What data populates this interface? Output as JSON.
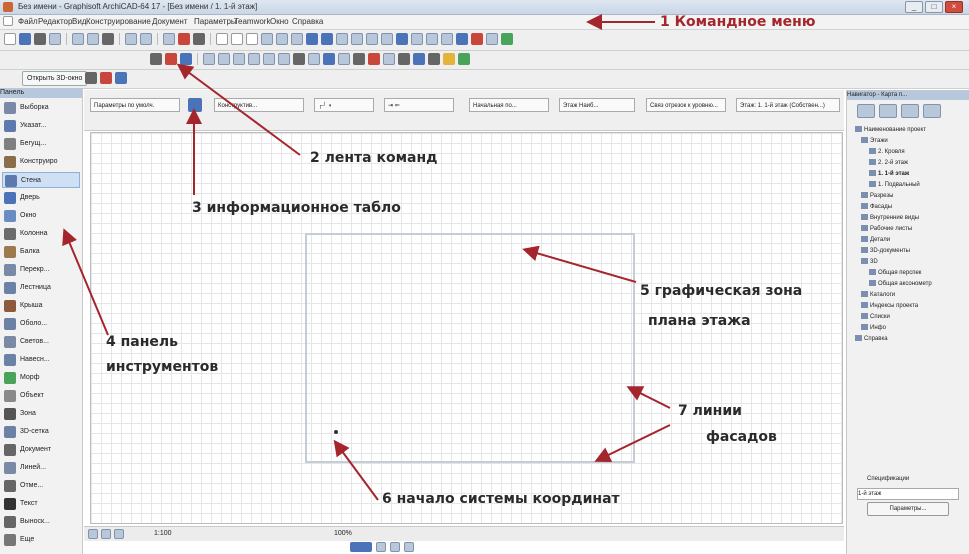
{
  "window": {
    "title": "Без имени - Graphisoft ArchiCAD-64 17 - [Без имени / 1. 1-й этаж]"
  },
  "menu": {
    "items": [
      "Файл",
      "Редактор",
      "Вид",
      "Конструирование",
      "Документ",
      "Параметры",
      "Teamwork",
      "Окно",
      "Справка"
    ],
    "annotation": "1 Командное меню"
  },
  "toolbar": {
    "open_3d_label": "Открыть 3D-окно",
    "annotation": "2 лента команд"
  },
  "info_box": {
    "annotation": "3 информационное табло",
    "param_label": "Параметры по умолч.",
    "construct_label": "Конструктив...",
    "foundation_label": "Начальная по...",
    "floor_label": "Этаж Наиб...",
    "link_label": "Связ отрезок к уровню...",
    "story_label": "Этаж: 1. 1-й этаж (Собствен...)",
    "story_value": "1. 1-й этаж"
  },
  "left_panel": {
    "title": "Панель",
    "annotation_line1": "4 панель",
    "annotation_line2": "инструментов",
    "items": [
      {
        "label": "Выборка"
      },
      {
        "label": "Указат..."
      },
      {
        "label": "Бегущ..."
      },
      {
        "label": "Конструиро"
      },
      {
        "label": "Стена"
      },
      {
        "label": "Дверь"
      },
      {
        "label": "Окно"
      },
      {
        "label": "Колонна"
      },
      {
        "label": "Балка"
      },
      {
        "label": "Перекр..."
      },
      {
        "label": "Лестница"
      },
      {
        "label": "Крыша"
      },
      {
        "label": "Оболо..."
      },
      {
        "label": "Светов..."
      },
      {
        "label": "Навесн..."
      },
      {
        "label": "Морф"
      },
      {
        "label": "Объект"
      },
      {
        "label": "Зона"
      },
      {
        "label": "3D-сетка"
      },
      {
        "label": "Документ"
      },
      {
        "label": "Линей..."
      },
      {
        "label": "Отме..."
      },
      {
        "label": "Текст"
      },
      {
        "label": "Выноск..."
      },
      {
        "label": "Еще"
      }
    ]
  },
  "canvas": {
    "annotation_zone_line1": "5 графическая зона",
    "annotation_zone_line2": "плана этажа",
    "annotation_origin": "6 начало системы координат",
    "annotation_facades_line1": "7 линии",
    "annotation_facades_line2": "фасадов"
  },
  "navigator": {
    "title": "Навигатор - Карта п...",
    "tree": [
      "Наименование проект",
      "Этажи",
      "2. Кровля",
      "2. 2-й этаж",
      "1. 1-й этаж",
      "1. Подвальный",
      "Разрезы",
      "Фасады",
      "Внутренние виды",
      "Рабочие листы",
      "Детали",
      "3D-документы",
      "3D",
      "Общая перспек",
      "Общая аксонометр",
      "Каталоги",
      "Индексы проекта",
      "Списки",
      "Инфо",
      "Справка"
    ],
    "properties_label": "Спецификации",
    "story_value": "1-й этаж",
    "params_button": "Параметры..."
  },
  "status": {
    "scale": "1:100",
    "zoom": "100%"
  }
}
